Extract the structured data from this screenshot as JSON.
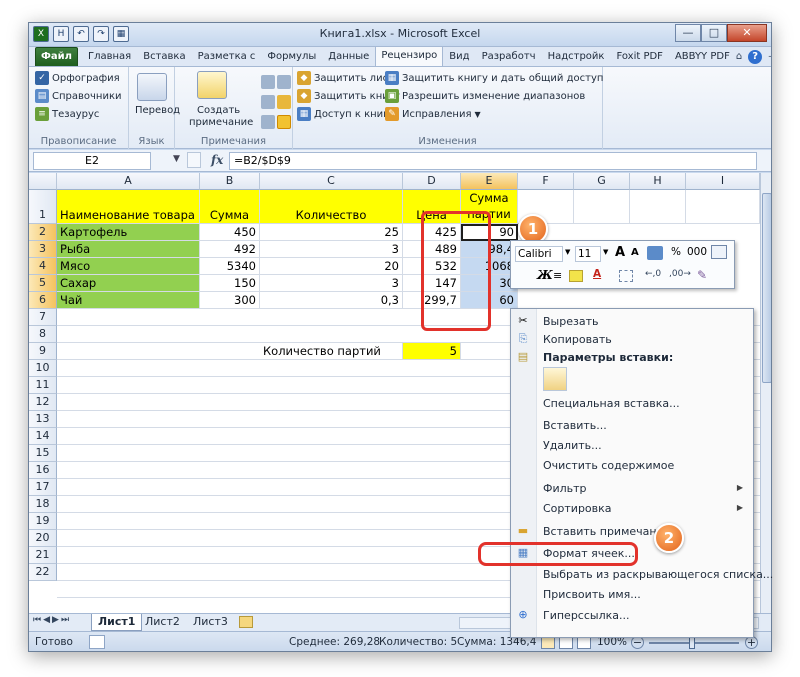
{
  "window": {
    "title": "Книга1.xlsx - Microsoft Excel",
    "min": "—",
    "max": "□",
    "close": "✕"
  },
  "qat": [
    "X",
    "H",
    "↶",
    "↷",
    "▦"
  ],
  "tabs": [
    "Файл",
    "Главная",
    "Вставка",
    "Разметка с",
    "Формулы",
    "Данные",
    "Рецензиро",
    "Вид",
    "Разработч",
    "Надстройк",
    "Foxit PDF",
    "ABBYY PDF"
  ],
  "tab_right": [
    "⌂",
    "?",
    "—",
    "⧉",
    "☒"
  ],
  "ribbon": {
    "proof": {
      "spell": "Орфография",
      "ref": "Справочники",
      "thes": "Тезаурус",
      "label": "Правописание"
    },
    "lang": {
      "translate": "Перевод",
      "label": "Язык"
    },
    "comments": {
      "new1": "Создать",
      "new2": "примечание",
      "label": "Примечания"
    },
    "changes": {
      "protect_sheet": "Защитить лист",
      "protect_book": "Защитить книгу",
      "share_access": "Доступ к книге",
      "protect_share": "Защитить книгу и дать общий доступ",
      "allow_ranges": "Разрешить изменение диапазонов",
      "track": "Исправления",
      "label": "Изменения"
    }
  },
  "formula_bar": {
    "namebox": "E2",
    "fx": "fx",
    "formula": "=B2/$D$9"
  },
  "columns": [
    "A",
    "B",
    "C",
    "D",
    "E",
    "F",
    "G",
    "H",
    "I"
  ],
  "rows": [
    "1",
    "2",
    "3",
    "4",
    "5",
    "6",
    "7",
    "8",
    "9",
    "10",
    "11",
    "12",
    "13",
    "14",
    "15",
    "16",
    "17",
    "18",
    "19",
    "20",
    "21",
    "22"
  ],
  "table": {
    "headers": [
      "Наименование товара",
      "Сумма",
      "Количество",
      "Цена",
      "Сумма",
      "партии"
    ],
    "rows": [
      [
        "Картофель",
        "450",
        "25",
        "425",
        "90"
      ],
      [
        "Рыба",
        "492",
        "3",
        "489",
        "98,4"
      ],
      [
        "Мясо",
        "5340",
        "20",
        "532",
        "1068"
      ],
      [
        "Сахар",
        "150",
        "3",
        "147",
        "30"
      ],
      [
        "Чай",
        "300",
        "0,3",
        "299,7",
        "60"
      ]
    ],
    "batch_label": "Количество партий",
    "batch_value": "5"
  },
  "mini_toolbar": {
    "font": "Calibri",
    "size": "11",
    "percent": "%",
    "thousands": "000",
    "bold": "Ж",
    "italic": "К"
  },
  "context_menu": [
    "Вырезать",
    "Копировать",
    "Параметры вставки:",
    "Специальная вставка...",
    "Вставить...",
    "Удалить...",
    "Очистить содержимое",
    "Фильтр",
    "Сортировка",
    "Вставить примечание",
    "Формат ячеек...",
    "Выбрать из раскрывающегося списка...",
    "Присвоить имя...",
    "Гиперссылка..."
  ],
  "badges": [
    "1",
    "2"
  ],
  "sheet_tabs": [
    "Лист1",
    "Лист2",
    "Лист3"
  ],
  "status": {
    "ready": "Готово",
    "avg": "Среднее: 269,28",
    "count": "Количество: 5",
    "sum": "Сумма: 1346,4",
    "zoom": "100%"
  },
  "colors": {
    "highlight": "#e2322b",
    "yellow": "#ffff00",
    "green": "#92d050",
    "selection": "#c5d9f1"
  }
}
